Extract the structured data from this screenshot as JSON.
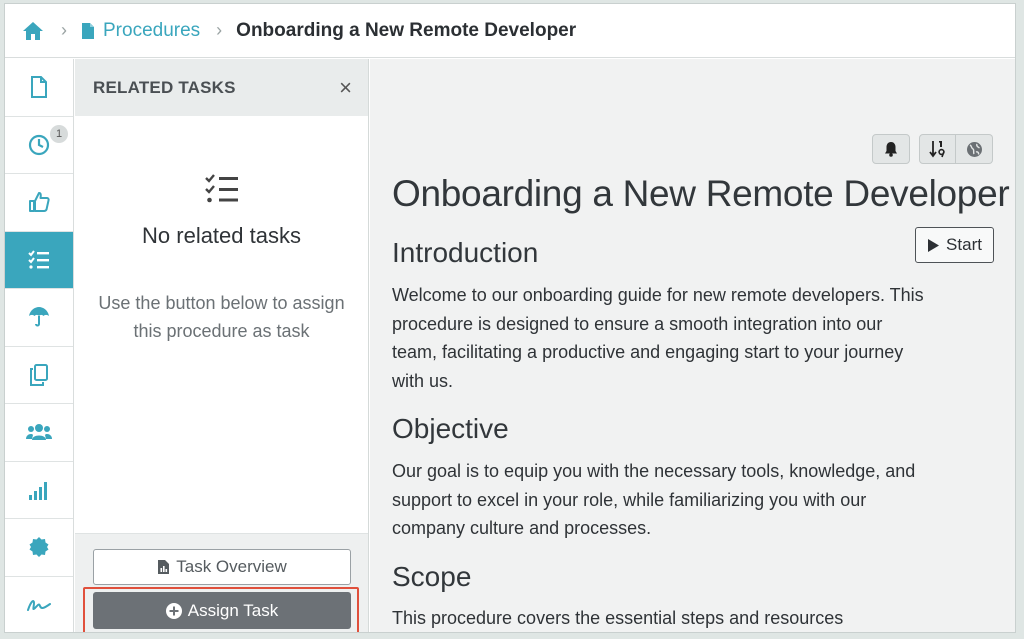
{
  "breadcrumb": {
    "home_icon": "home-icon",
    "section": "Procedures",
    "current": "Onboarding a New Remote Developer",
    "separator": "›"
  },
  "colors": {
    "accent": "#3aa6bd",
    "assign_button": "#6c7176",
    "highlight_outline": "#e0503c"
  },
  "sidebar": {
    "items": [
      {
        "icon": "document-icon"
      },
      {
        "icon": "clock-icon",
        "badge": "1"
      },
      {
        "icon": "thumbs-up-icon"
      },
      {
        "icon": "task-list-icon",
        "active": true
      },
      {
        "icon": "umbrella-icon"
      },
      {
        "icon": "copy-icon"
      },
      {
        "icon": "users-icon"
      },
      {
        "icon": "signal-bars-icon"
      },
      {
        "icon": "badge-seal-icon"
      },
      {
        "icon": "signature-icon"
      }
    ]
  },
  "panel": {
    "title": "RELATED TASKS",
    "close": "×",
    "empty_title": "No related tasks",
    "empty_text": "Use the button below to assign this procedure as task",
    "overview_label": "Task Overview",
    "assign_label": "Assign Task"
  },
  "main": {
    "title": "Onboarding a New Remote Developer",
    "start_label": "Start",
    "sections": [
      {
        "heading": "Introduction",
        "text": "Welcome to our onboarding guide for new remote developers. This procedure is designed to ensure a smooth integration into our team, facilitating a productive and engaging start to your journey with us."
      },
      {
        "heading": "Objective",
        "text": "Our goal is to equip you with the necessary tools, knowledge, and support to excel in your role, while familiarizing you with our company culture and processes."
      },
      {
        "heading": "Scope",
        "text": "This procedure covers the essential steps and resources"
      }
    ]
  }
}
